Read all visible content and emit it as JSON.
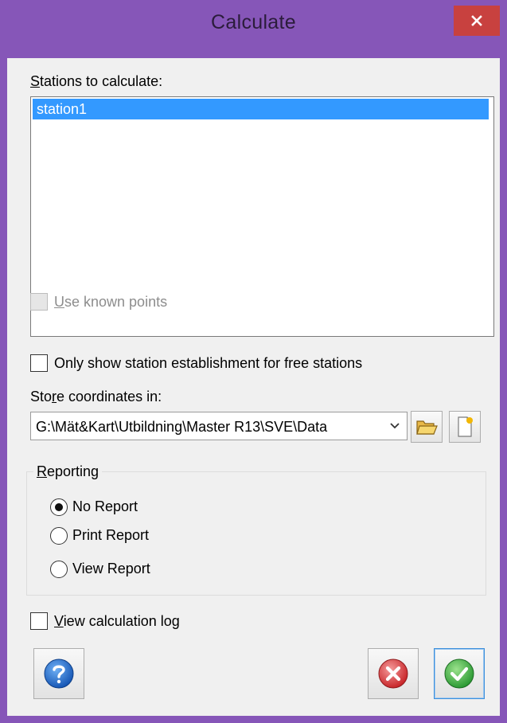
{
  "window": {
    "title": "Calculate",
    "close_icon": "close-icon"
  },
  "stations": {
    "label": "Stations to calculate:",
    "items": [
      "station1"
    ],
    "selected_index": 0
  },
  "use_known_points": {
    "label": "Use known points",
    "checked": false,
    "enabled": false
  },
  "only_free_stations": {
    "label": "Only show station establishment for free stations",
    "checked": false
  },
  "store": {
    "label": "Store coordinates in:",
    "path": "G:\\Mät&Kart\\Utbildning\\Master R13\\SVE\\Data",
    "browse_icon": "folder-open-icon",
    "new_icon": "new-file-icon"
  },
  "reporting": {
    "label": "Reporting",
    "options": [
      "No Report",
      "Print Report",
      "View Report"
    ],
    "selected": "No Report"
  },
  "view_log": {
    "label": "View calculation log",
    "checked": false
  },
  "buttons": {
    "help_icon": "help-icon",
    "cancel_icon": "cancel-icon",
    "ok_icon": "ok-checkmark-icon"
  },
  "colors": {
    "window_frame": "#8656b8",
    "close_button": "#c8413f",
    "selection": "#3399ff",
    "dialog_background": "#f0f0f0"
  }
}
